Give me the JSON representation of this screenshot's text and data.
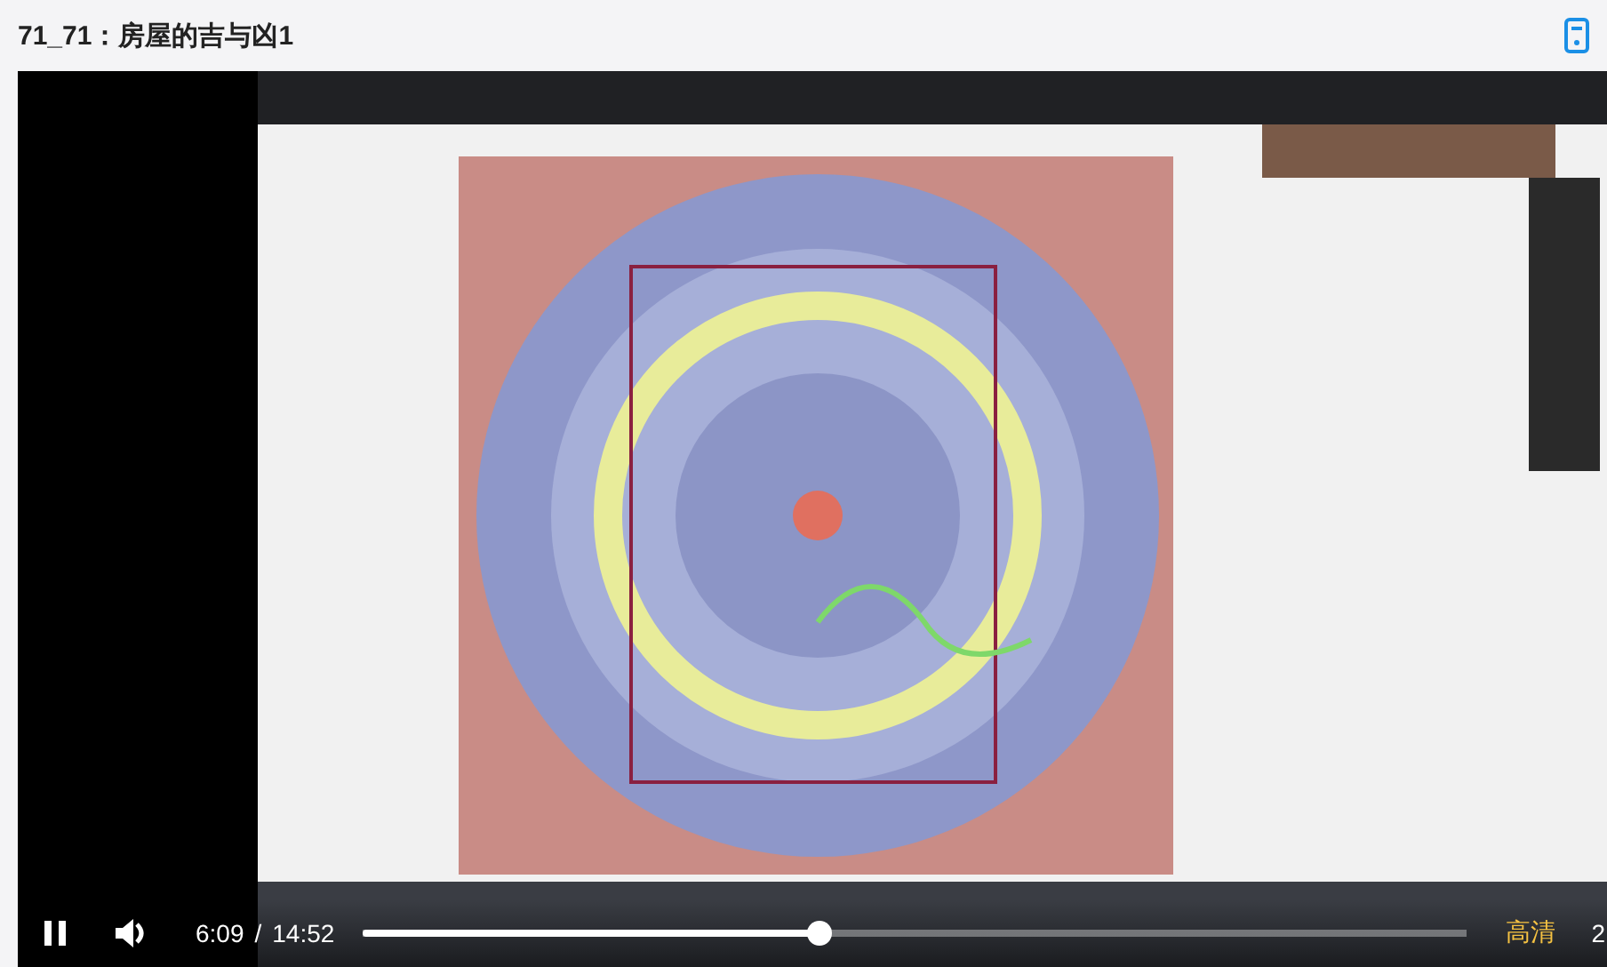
{
  "page": {
    "title": "71_71：房屋的吉与凶1"
  },
  "player": {
    "playing": true,
    "muted": false,
    "current_time": "6:09",
    "separator": "/",
    "duration": "14:52",
    "progress": {
      "level": 0.414
    },
    "quality": "高清",
    "speed": "2"
  }
}
